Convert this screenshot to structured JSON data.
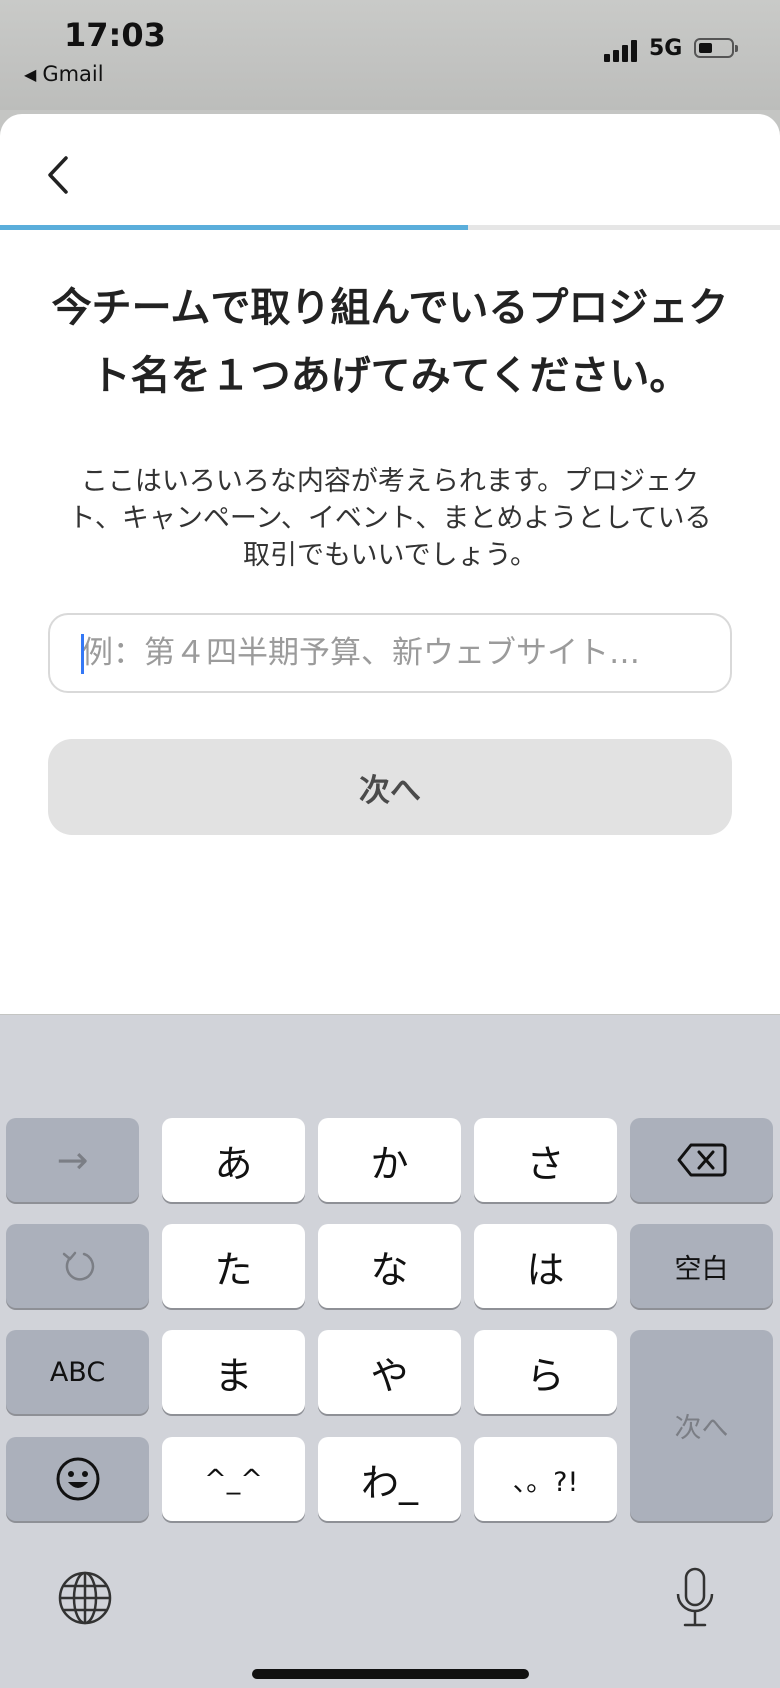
{
  "status_bar": {
    "time": "17:03",
    "back_app": "Gmail",
    "network": "5G"
  },
  "form": {
    "progress_percent": 60,
    "title": "今チームで取り組んでいるプロジェクト名を１つあげてみてください。",
    "description": "ここはいろいろな内容が考えられます。プロジェクト、キャンペーン、イベント、まとめようとしている取引でもいいでしょう。",
    "input_placeholder": "例：第４四半期予算、新ウェブサイト…",
    "input_value": "",
    "next_label": "次へ"
  },
  "keyboard": {
    "arrow": "→",
    "row1": [
      "あ",
      "か",
      "さ"
    ],
    "row2": [
      "た",
      "な",
      "は"
    ],
    "row3": [
      "ま",
      "や",
      "ら"
    ],
    "row4": [
      "^_^",
      "わ_",
      "、。?!"
    ],
    "space_label": "空白",
    "abc_label": "ABC",
    "next_label": "次へ"
  },
  "colors": {
    "accent": "#5aaedb",
    "caret": "#3478f6",
    "button_bg": "#e2e2e2",
    "keyboard_bg": "#d1d3d9",
    "function_key": "#abb0bb"
  }
}
